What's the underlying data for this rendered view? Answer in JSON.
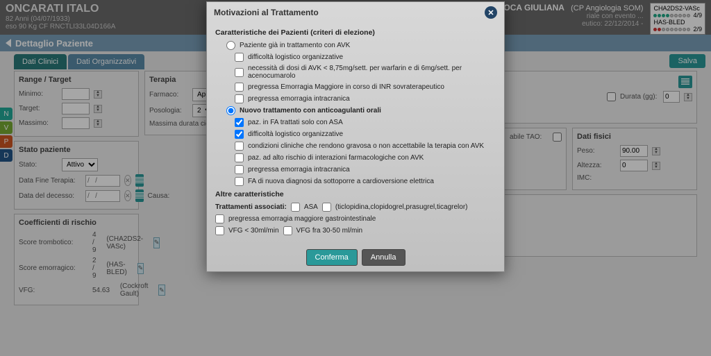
{
  "header": {
    "patient_name": "ONCARATI ITALO",
    "patient_line1": "82 Anni (04/07/1933)",
    "patient_line2": "eso 90 Kg CF RNCTLI33L04D166A",
    "user": "GUAZZALOCA GIULIANA",
    "context": "(CP Angiologia SOM)",
    "event_text": "riale con evento ...",
    "event_date": "eutico: 22/12/2014 -",
    "risk1_label": "CHA2DS2-VASc",
    "risk1_val": "4/9",
    "risk2_label": "HAS-BLED",
    "risk2_val": "2/9"
  },
  "subbar": {
    "title": "Dettaglio Paziente"
  },
  "tabs": {
    "t1": "Dati Clinici",
    "t2": "Dati Organizzativi"
  },
  "salva": "Salva",
  "sidebar": {
    "n": "N",
    "v": "V",
    "p": "P",
    "d": "D"
  },
  "range": {
    "title": "Range / Target",
    "minimo": "Minimo:",
    "target": "Target:",
    "massimo": "Massimo:"
  },
  "terapia": {
    "title": "Terapia",
    "farmaco": "Farmaco:",
    "farmaco_val": "Apixaba",
    "posologia": "Posologia:",
    "posologia_val": "2",
    "durata": "Massima durata cic",
    "durata_gg": "Durata (gg):",
    "durata_val": "0"
  },
  "stato": {
    "title": "Stato paziente",
    "stato": "Stato:",
    "stato_val": "Attivo",
    "fine": "Data Fine Terapia:",
    "decesso": "Data del decesso:",
    "causa": "Causa:",
    "tao": "abile TAO:",
    "date_ph": "/   /"
  },
  "coef": {
    "title": "Coefficienti di rischio",
    "r1_label": "Score trombotico:",
    "r1_val": "4 / 9",
    "r1_scale": "(CHA2DS2-VASc)",
    "r2_label": "Score emorragico:",
    "r2_val": "2 / 9",
    "r2_scale": "(HAS-BLED)",
    "r3_label": "VFG:",
    "r3_val": "54.63",
    "r3_scale": "(Cockroft Gault)"
  },
  "fisici": {
    "title": "Dati fisici",
    "peso": "Peso:",
    "peso_val": "90.00",
    "altezza": "Altezza:",
    "altezza_val": "0",
    "imc": "IMC:"
  },
  "modal": {
    "title": "Motivazioni al Trattamento",
    "sec1": "Caratteristiche dei Pazienti (criteri di elezione)",
    "r1": "Paziente già in trattamento con AVK",
    "c1": "difficoltà logistico organizzative",
    "c2": "necessità di dosi di AVK < 8,75mg/sett. per warfarin e di 6mg/sett. per acenocumarolo",
    "c3": "pregressa Emorragia Maggiore in corso di INR sovraterapeutico",
    "c4": "pregressa emorragia intracranica",
    "r2": "Nuovo trattamento con anticoagulanti orali",
    "c5": "paz. in FA trattati solo con ASA",
    "c6": "difficoltà logistico organizzative",
    "c7": "condizioni cliniche che rendono gravosa o non accettabile la terapia con AVK",
    "c8": "paz. ad alto rischio di interazioni farmacologiche con AVK",
    "c9": "pregressa emorragia intracranica",
    "c10": "FA di nuova diagnosi da sottoporre a cardioversione elettrica",
    "sec2": "Altre caratteristiche",
    "assoc": "Trattamenti associati:",
    "a1": "ASA",
    "a2": "(ticlopidina,clopidogrel,prasugrel,ticagrelor)",
    "c11": "pregressa emorragia maggiore gastrointestinale",
    "c12": "VFG < 30ml/min",
    "c13": "VFG fra 30-50 ml/min",
    "ok": "Conferma",
    "cancel": "Annulla"
  }
}
